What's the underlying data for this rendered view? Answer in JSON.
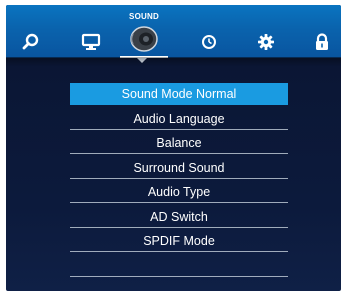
{
  "header": {
    "active_tab_title": "SOUND"
  },
  "tabs": [
    {
      "icon": "search-icon"
    },
    {
      "icon": "monitor-icon"
    },
    {
      "icon": "speaker-icon",
      "active": true
    },
    {
      "icon": "clock-icon"
    },
    {
      "icon": "gear-icon"
    },
    {
      "icon": "lock-icon"
    }
  ],
  "menu": {
    "items": [
      {
        "label": "Sound Mode Normal",
        "selected": true
      },
      {
        "label": "Audio Language"
      },
      {
        "label": "Balance"
      },
      {
        "label": "Surround Sound"
      },
      {
        "label": "Audio Type"
      },
      {
        "label": "AD Switch"
      },
      {
        "label": "SPDIF Mode"
      },
      {
        "label": ""
      }
    ]
  },
  "colors": {
    "topbar": "#0a63ad",
    "selected": "#1a9be1",
    "background": "#0b1736"
  }
}
